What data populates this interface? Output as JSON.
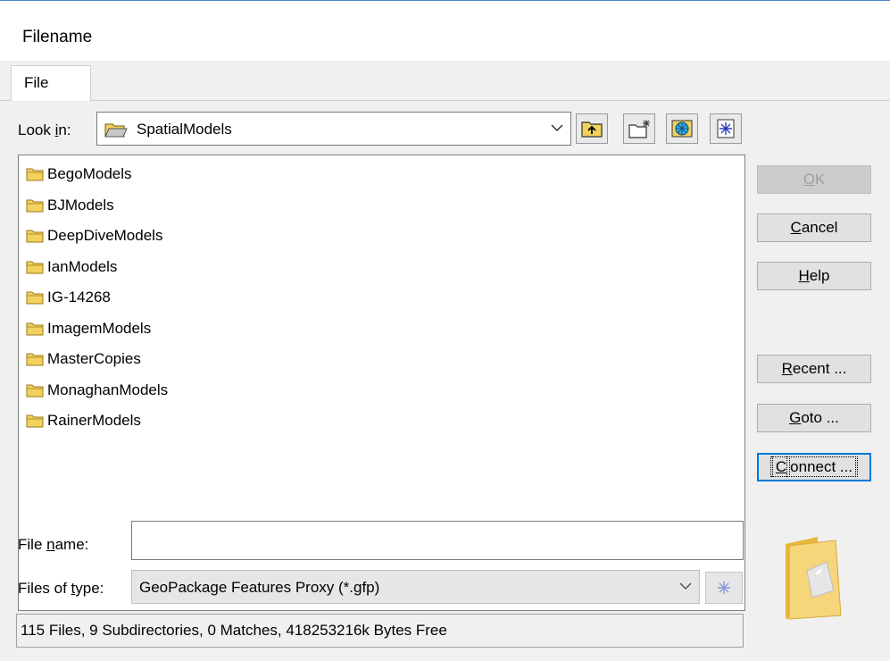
{
  "window": {
    "title": "Filename"
  },
  "tabs": [
    {
      "label": "File"
    }
  ],
  "look_in": {
    "label_pre": "Look ",
    "label_key": "i",
    "label_post": "n:",
    "value": "SpatialModels"
  },
  "toolbar": {
    "up_icon": "up-folder-icon",
    "new_folder_icon": "new-folder-icon",
    "refresh_icon": "globe-icon",
    "extra_icon": "asterisk-icon"
  },
  "folders": [
    "BegoModels",
    "BJModels",
    "DeepDiveModels",
    "IanModels",
    "IG-14268",
    "ImagemModels",
    "MasterCopies",
    "MonaghanModels",
    "RainerModels"
  ],
  "buttons": {
    "ok": {
      "key": "O",
      "rest": "K"
    },
    "cancel": {
      "key": "C",
      "rest": "ancel"
    },
    "help": {
      "key": "H",
      "rest": "elp"
    },
    "recent": {
      "key": "R",
      "rest": "ecent ..."
    },
    "goto": {
      "key": "G",
      "rest": "oto ..."
    },
    "connect": {
      "key": "C",
      "rest": "onnect ..."
    }
  },
  "file_name": {
    "label_pre": "File ",
    "label_key": "n",
    "label_post": "ame:",
    "value": ""
  },
  "file_type": {
    "label_pre": "Files of ",
    "label_key": "t",
    "label_post": "ype:",
    "value": "GeoPackage Features Proxy (*.gfp)"
  },
  "status": {
    "text": "115 Files, 9 Subdirectories, 0 Matches, 418253216k Bytes Free"
  },
  "colors": {
    "folder_fill": "#f2d15d",
    "folder_edge": "#9c7a1c",
    "focus_blue": "#0078d7"
  }
}
